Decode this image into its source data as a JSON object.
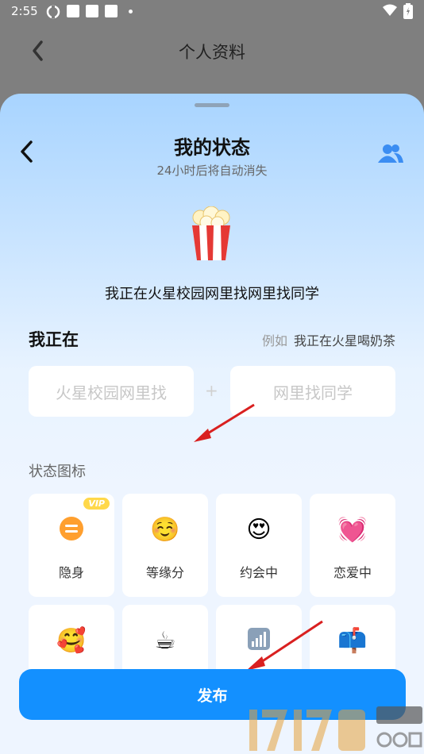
{
  "status_bar": {
    "time": "2:55"
  },
  "top_nav": {
    "title": "个人资料"
  },
  "sheet": {
    "title": "我的状态",
    "subtitle": "24小时后将自动消失",
    "current_status": "我正在火星校园网里找网里找同学",
    "section_title": "我正在",
    "example_label": "例如",
    "example_text": "我正在火星喝奶茶",
    "input_left_placeholder": "火星校园网里找",
    "input_plus": "+",
    "input_right_placeholder": "网里找同学",
    "icons_title": "状态图标",
    "tiles": [
      {
        "label": "隐身",
        "icon": "equals-icon",
        "badge": "VIP"
      },
      {
        "label": "等缘分",
        "icon": "smiling-face-icon"
      },
      {
        "label": "约会中",
        "icon": "heart-eyes-icon"
      },
      {
        "label": "恋爱中",
        "icon": "beating-heart-icon"
      },
      {
        "label": "",
        "icon": "smiling-face-hearts-icon"
      },
      {
        "label": "",
        "icon": "coffee-icon"
      },
      {
        "label": "",
        "icon": "bar-chart-icon"
      },
      {
        "label": "",
        "icon": "mailbox-icon"
      }
    ],
    "publish_label": "发布"
  },
  "colors": {
    "accent": "#1390ff",
    "vip": "#ffd84a"
  }
}
